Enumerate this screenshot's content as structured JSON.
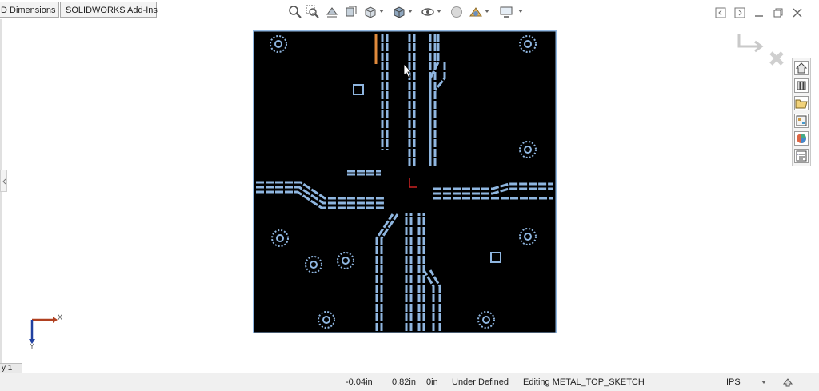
{
  "tabs": [
    {
      "label": "D Dimensions"
    },
    {
      "label": "SOLIDWORKS Add-Ins"
    }
  ],
  "view_toolbar": {
    "icons": [
      "zoom-to-fit-icon",
      "zoom-to-area-icon",
      "previous-view-icon",
      "section-view-icon",
      "view-orientation-icon",
      "display-style-icon",
      "hide-show-items-icon",
      "edit-appearance-icon",
      "apply-scene-icon",
      "view-settings-icon"
    ]
  },
  "window_controls": {
    "icons": [
      "tile-left-icon",
      "tile-right-icon",
      "minimize-icon",
      "restore-icon",
      "close-icon"
    ]
  },
  "confirmation_corner": {
    "icons": [
      "exit-sketch-icon",
      "cancel-sketch-icon"
    ]
  },
  "task_pane": {
    "icons": [
      "home-icon",
      "design-library-icon",
      "file-explorer-icon",
      "view-palette-icon",
      "appearances-icon",
      "custom-properties-icon"
    ]
  },
  "triad": {
    "x_label": "X",
    "y_label": "Y"
  },
  "sheet_tab": {
    "label": "y 1"
  },
  "status": {
    "x": "-0.04in",
    "y": "0.82in",
    "z": "0in",
    "state": "Under Defined",
    "editing": "Editing METAL_TOP_SKETCH",
    "units": "IPS"
  },
  "colors": {
    "board": "#000000",
    "trace": "#8fb6e0",
    "trace_dark": "#2d4f73",
    "selected": "#e08a3c",
    "origin": "#cc2222"
  }
}
